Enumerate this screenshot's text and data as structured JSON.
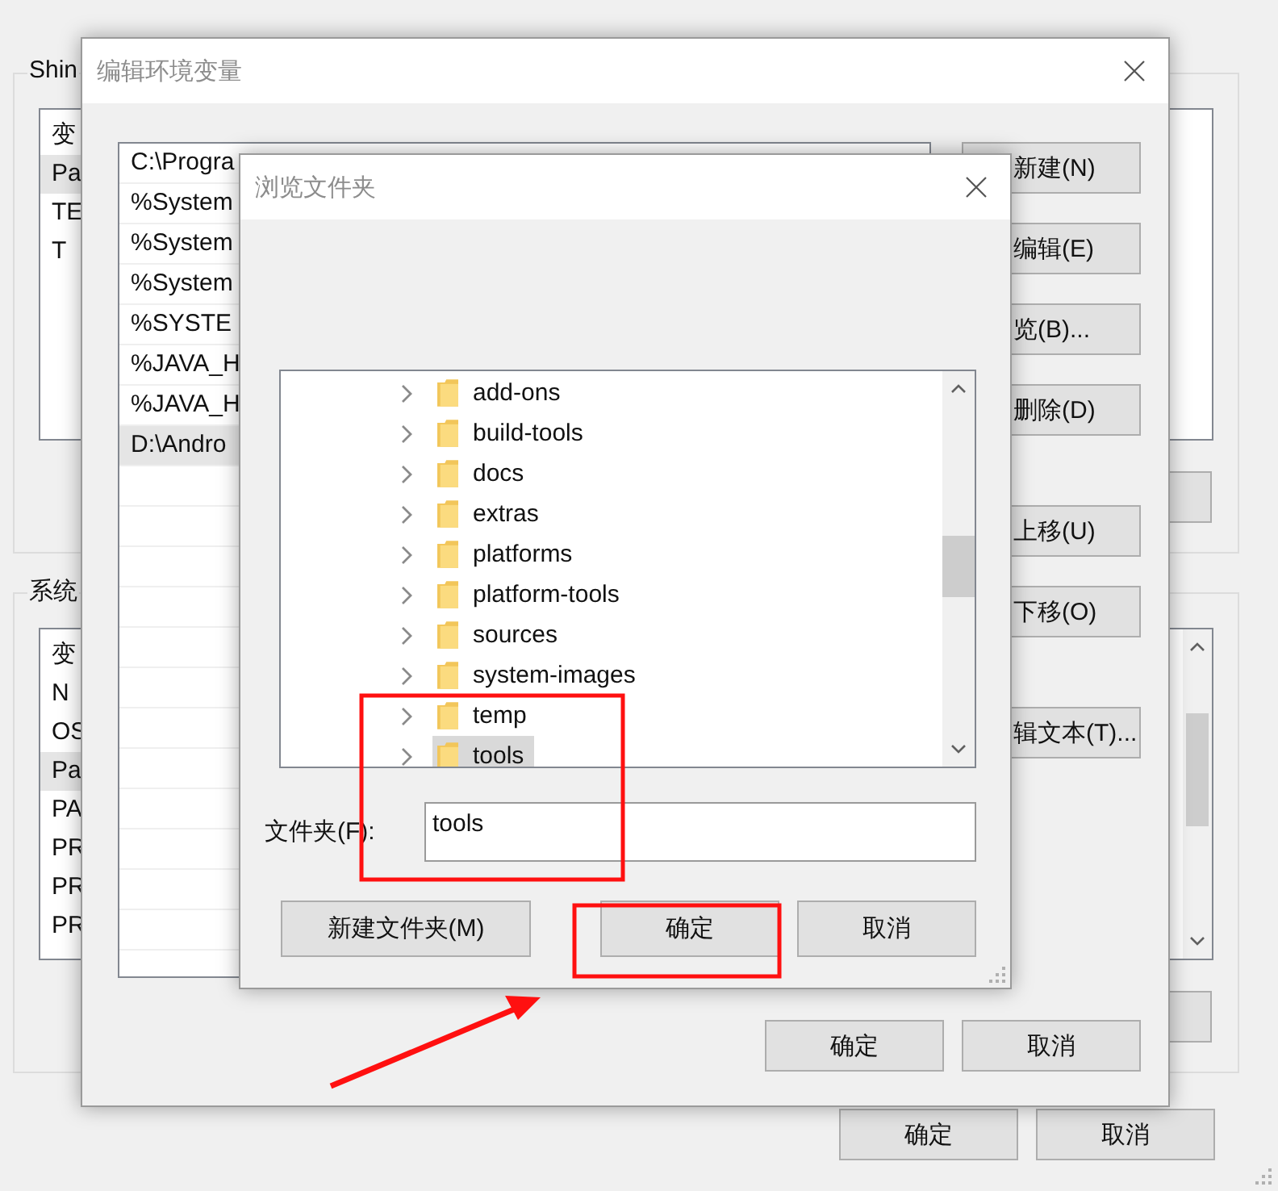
{
  "settings_window": {
    "user_vars": {
      "legend": "Shin",
      "rows": [
        {
          "text": "变",
          "selected": false
        },
        {
          "text": "Pa",
          "selected": true
        },
        {
          "text": "TE",
          "selected": false
        },
        {
          "text": "T",
          "selected": false
        }
      ]
    },
    "system_vars": {
      "legend": "系统",
      "rows": [
        {
          "text": "变",
          "selected": false
        },
        {
          "text": "N",
          "selected": false
        },
        {
          "text": "OS",
          "selected": false
        },
        {
          "text": "Pa",
          "selected": true
        },
        {
          "text": "PA",
          "selected": false
        },
        {
          "text": "PR",
          "selected": false
        },
        {
          "text": "PR",
          "selected": false
        },
        {
          "text": "PR",
          "selected": false
        }
      ]
    },
    "buttons": [
      "确定",
      "取消"
    ]
  },
  "edit_dialog": {
    "title": "编辑环境变量",
    "paths": [
      {
        "text": "C:\\Progra",
        "selected": false
      },
      {
        "text": "%System",
        "selected": false
      },
      {
        "text": "%System",
        "selected": false
      },
      {
        "text": "%System",
        "selected": false
      },
      {
        "text": "%SYSTE",
        "selected": false
      },
      {
        "text": "%JAVA_H",
        "selected": false
      },
      {
        "text": "%JAVA_H",
        "selected": false
      },
      {
        "text": "D:\\Andro",
        "selected": true
      }
    ],
    "side_buttons": [
      "新建(N)",
      "编辑(E)",
      "览(B)...",
      "删除(D)",
      "上移(U)",
      "下移(O)",
      "辑文本(T)..."
    ],
    "buttons": [
      "确定",
      "取消"
    ]
  },
  "browse_dialog": {
    "title": "浏览文件夹",
    "folders": [
      {
        "name": "add-ons",
        "expanded": false,
        "selected": false
      },
      {
        "name": "build-tools",
        "expanded": false,
        "selected": false
      },
      {
        "name": "docs",
        "expanded": false,
        "selected": false
      },
      {
        "name": "extras",
        "expanded": false,
        "selected": false
      },
      {
        "name": "platforms",
        "expanded": false,
        "selected": false
      },
      {
        "name": "platform-tools",
        "expanded": false,
        "selected": false
      },
      {
        "name": "sources",
        "expanded": false,
        "selected": false
      },
      {
        "name": "system-images",
        "expanded": false,
        "selected": false
      },
      {
        "name": "temp",
        "expanded": false,
        "selected": false
      },
      {
        "name": "tools",
        "expanded": false,
        "selected": true
      }
    ],
    "folder_field": {
      "label": "文件夹(F):",
      "value": "tools"
    },
    "buttons": [
      "新建文件夹(M)",
      "确定",
      "取消"
    ]
  }
}
